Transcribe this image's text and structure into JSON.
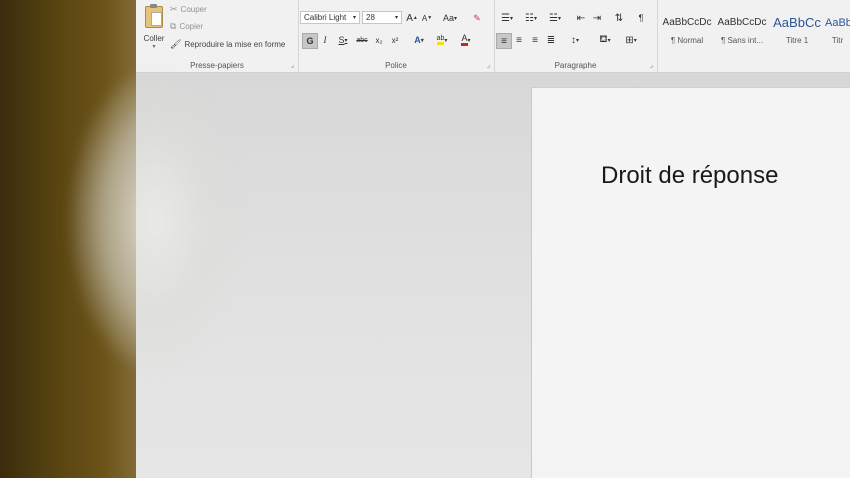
{
  "clipboard": {
    "paste_label": "Coller",
    "cut_label": "Couper",
    "copy_label": "Copier",
    "format_painter_label": "Reproduire la mise en forme",
    "group_label": "Presse-papiers"
  },
  "font": {
    "family": "Calibri Light",
    "size": "28",
    "grow_label": "A",
    "shrink_label": "A",
    "case_label": "Aa",
    "bold_label": "G",
    "italic_label": "I",
    "underline_label": "S",
    "strike_label": "abc",
    "subscript_label": "x₂",
    "superscript_label": "x²",
    "effects_label": "A",
    "highlight_label": "ab",
    "color_label": "A",
    "group_label": "Police"
  },
  "paragraph": {
    "pilcrow_label": "¶",
    "group_label": "Paragraphe"
  },
  "styles": {
    "items": [
      {
        "sample": "AaBbCcDc",
        "name": "¶ Normal"
      },
      {
        "sample": "AaBbCcDc",
        "name": "¶ Sans int..."
      },
      {
        "sample": "AaBbCc",
        "name": "Titre 1"
      },
      {
        "sample": "AaBb",
        "name": "Titr"
      }
    ]
  },
  "document": {
    "title": "Droit de réponse"
  },
  "colors": {
    "accent_blue": "#2b5797",
    "font_color_red": "#d21f1f",
    "highlight_yellow": "#f2e200"
  }
}
